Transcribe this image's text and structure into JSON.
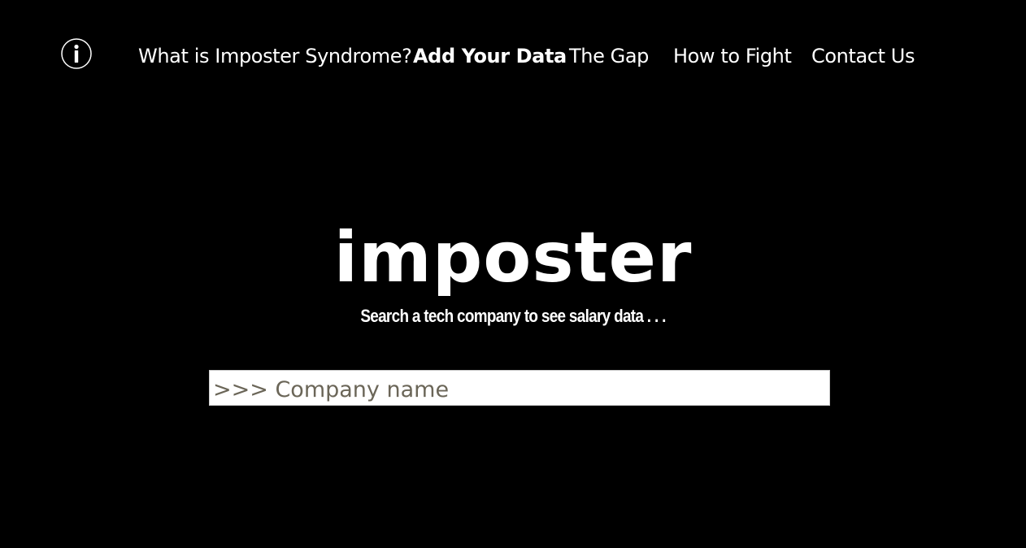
{
  "nav": {
    "info_icon": "info-icon",
    "items": [
      {
        "label": "What is Imposter Syndrome?",
        "active": false
      },
      {
        "label": "Add Your Data",
        "active": true
      },
      {
        "label": "The Gap",
        "active": false
      },
      {
        "label": "How to Fight",
        "active": false
      },
      {
        "label": "Contact Us",
        "active": false
      }
    ]
  },
  "hero": {
    "logo": "imposter",
    "tagline": "Search a tech company to see salary data . . ."
  },
  "search": {
    "placeholder": ">>> Company name",
    "value": ""
  },
  "colors": {
    "background": "#000000",
    "text": "#ffffff",
    "input_background": "#ffffff",
    "placeholder": "#6b6658"
  }
}
